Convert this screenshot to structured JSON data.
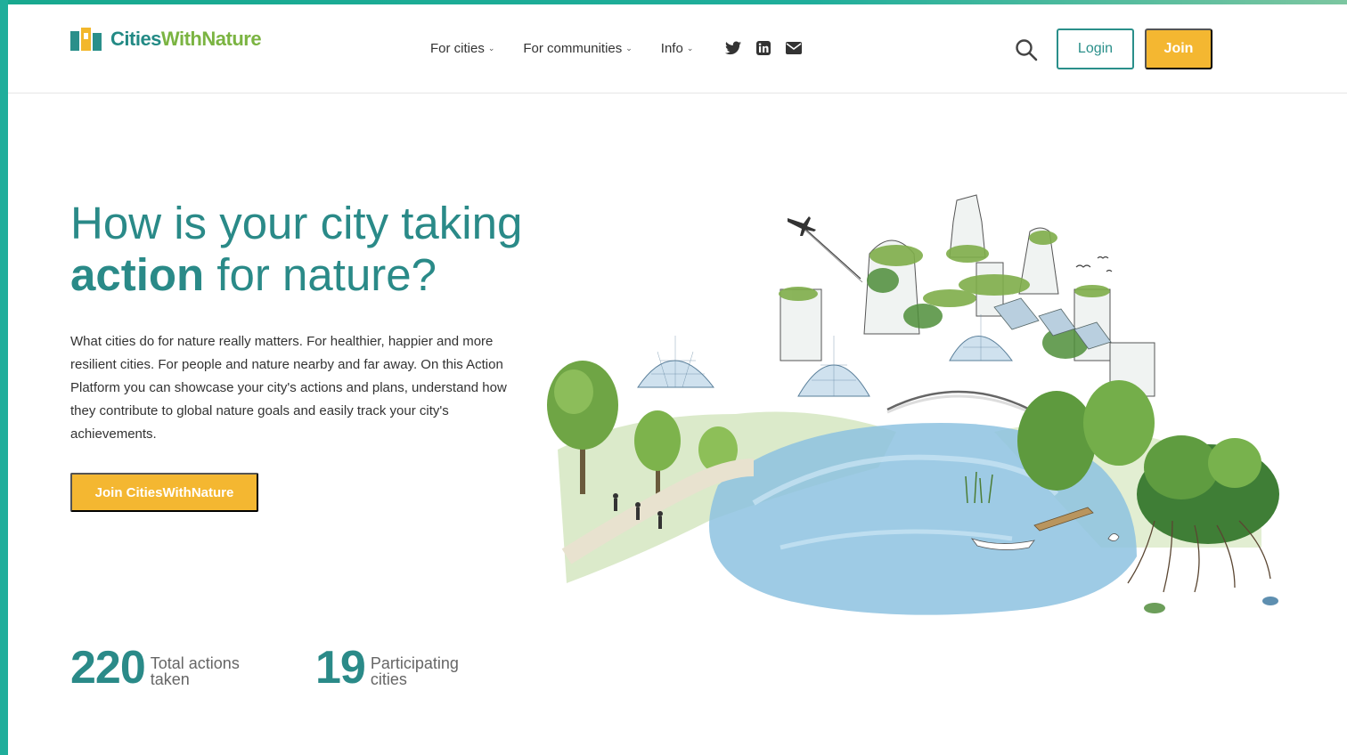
{
  "brand": {
    "name_part1": "Cities",
    "name_part2": "WithNature",
    "accent_teal": "#2a8a88",
    "accent_yellow": "#f4b731"
  },
  "nav": {
    "items": [
      {
        "label": "For cities",
        "icon": "chevron-down-icon"
      },
      {
        "label": "For communities",
        "icon": "chevron-down-icon"
      },
      {
        "label": "Info",
        "icon": "chevron-down-icon"
      }
    ],
    "social": [
      "twitter-icon",
      "linkedin-icon",
      "email-icon"
    ]
  },
  "header": {
    "search_icon": "search-icon",
    "login_label": "Login",
    "join_label": "Join"
  },
  "hero": {
    "title_line1": "How is your city taking",
    "title_bold": "action",
    "title_rest": " for nature?",
    "body": "What cities do for nature really matters. For healthier, happier and more resilient cities. For people and nature nearby and far away. On this Action Platform you can showcase your city's actions and plans, understand how they contribute to global nature goals and easily track your city's achievements.",
    "cta_label": "Join CitiesWithNature"
  },
  "stats": [
    {
      "value": "220",
      "label": "Total actions taken"
    },
    {
      "value": "19",
      "label": "Participating cities"
    }
  ]
}
